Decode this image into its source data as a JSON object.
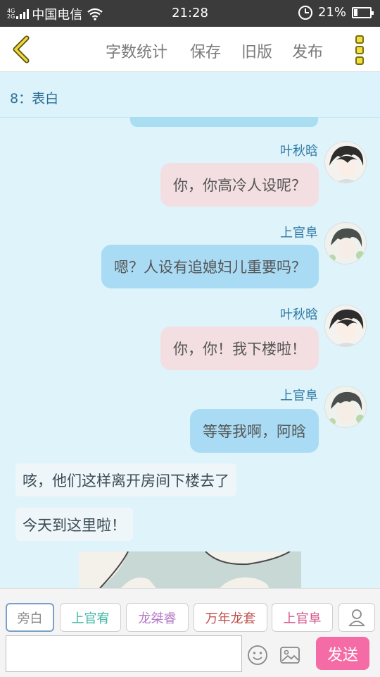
{
  "status_bar": {
    "network": [
      "4G",
      "2G"
    ],
    "carrier": "中国电信",
    "time": "21:28",
    "battery": "21%"
  },
  "toolbar": {
    "word_count": "字数统计",
    "save": "保存",
    "old_version": "旧版",
    "publish": "发布"
  },
  "section": {
    "title": "8：表白"
  },
  "messages": [
    {
      "speaker": "叶秋晗",
      "text": "你，你高冷人设呢？",
      "bubble_color": "#f3dfe2"
    },
    {
      "speaker": "上官阜",
      "text": "嗯？人设有追媳妇儿重要吗？",
      "bubble_color": "#a9dcf4"
    },
    {
      "speaker": "叶秋晗",
      "text": "你，你！我下楼啦！",
      "bubble_color": "#f3dfe2"
    },
    {
      "speaker": "上官阜",
      "text": "等等我啊，阿晗",
      "bubble_color": "#a9dcf4"
    }
  ],
  "narration": [
    "咳，他们这样离开房间下楼去了",
    "今天到这里啦！"
  ],
  "roles": [
    {
      "label": "旁白",
      "color": "#888888"
    },
    {
      "label": "上官宥",
      "color": "#41b7a6"
    },
    {
      "label": "龙桀睿",
      "color": "#b57cc7"
    },
    {
      "label": "万年龙套",
      "color": "#c0504d"
    },
    {
      "label": "上官阜",
      "color": "#d2558a"
    }
  ],
  "composer": {
    "send": "发送"
  },
  "icons": [
    "back-arrow-icon",
    "more-menu-icon",
    "add-role-icon",
    "emoji-icon",
    "image-icon",
    "wifi-icon",
    "alarm-icon",
    "battery-icon"
  ]
}
